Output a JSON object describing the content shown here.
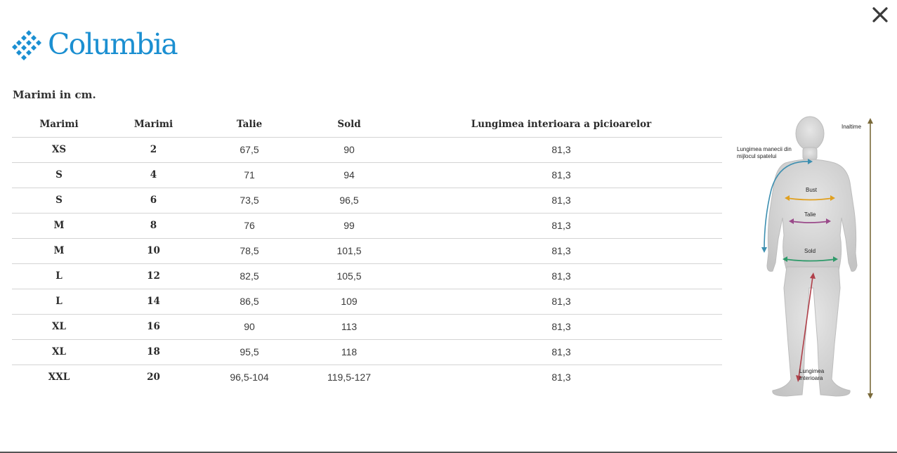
{
  "brand": {
    "name": "Columbia",
    "color": "#1b8fd1"
  },
  "icons": {
    "close": "close-icon",
    "logo": "columbia-diamond-logo"
  },
  "section_title": "Marimi in cm.",
  "table": {
    "headers": [
      "Marimi",
      "Marimi",
      "Talie",
      "Sold",
      "Lungimea interioara a picioarelor"
    ],
    "rows": [
      [
        "XS",
        "2",
        "67,5",
        "90",
        "81,3"
      ],
      [
        "S",
        "4",
        "71",
        "94",
        "81,3"
      ],
      [
        "S",
        "6",
        "73,5",
        "96,5",
        "81,3"
      ],
      [
        "M",
        "8",
        "76",
        "99",
        "81,3"
      ],
      [
        "M",
        "10",
        "78,5",
        "101,5",
        "81,3"
      ],
      [
        "L",
        "12",
        "82,5",
        "105,5",
        "81,3"
      ],
      [
        "L",
        "14",
        "86,5",
        "109",
        "81,3"
      ],
      [
        "XL",
        "16",
        "90",
        "113",
        "81,3"
      ],
      [
        "XL",
        "18",
        "95,5",
        "118",
        "81,3"
      ],
      [
        "XXL",
        "20",
        "96,5-104",
        "119,5-127",
        "81,3"
      ]
    ]
  },
  "figure": {
    "labels": {
      "height": "Inaltime",
      "sleeve_line1": "Lungimea manecii din",
      "sleeve_line2": "mijlocul spatelui",
      "bust": "Bust",
      "waist": "Talie",
      "hip": "Sold",
      "inseam_line1": "Lungimea",
      "inseam_line2": "interioara"
    },
    "colors": {
      "height": "#7a6a3a",
      "sleeve": "#3d8fb0",
      "bust": "#e0a020",
      "waist": "#9a4a8a",
      "hip": "#2f9a6a",
      "inseam": "#b0404a"
    }
  }
}
